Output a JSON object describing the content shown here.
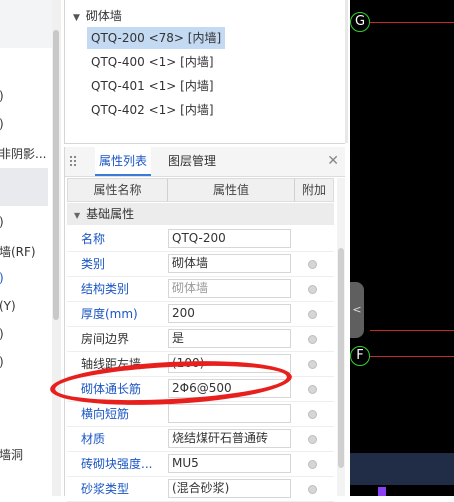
{
  "left_partial": {
    "items": [
      {
        "text": ")",
        "style": "normal"
      },
      {
        "text": ")",
        "style": "normal"
      },
      {
        "text": "非阴影...",
        "style": "normal"
      },
      {
        "text": ")",
        "style": "normal"
      },
      {
        "text": "墙(RF)",
        "style": "normal"
      },
      {
        "text": ")",
        "style": "blue"
      },
      {
        "text": "(Y)",
        "style": "normal"
      },
      {
        "text": ")",
        "style": "normal"
      },
      {
        "text": ")",
        "style": "normal"
      },
      {
        "text": "墙洞",
        "style": "normal"
      }
    ]
  },
  "tree": {
    "root_label": "砌体墙",
    "items": [
      {
        "label": "QTQ-200 <78> [内墙]",
        "selected": true
      },
      {
        "label": "QTQ-400 <1> [内墙]",
        "selected": false
      },
      {
        "label": "QTQ-401 <1> [内墙]",
        "selected": false
      },
      {
        "label": "QTQ-402 <1> [内墙]",
        "selected": false
      }
    ]
  },
  "properties": {
    "tabs": [
      {
        "label": "属性列表",
        "active": true
      },
      {
        "label": "图层管理",
        "active": false
      }
    ],
    "columns": {
      "name": "属性名称",
      "value": "属性值",
      "extra": "附加"
    },
    "group": "基础属性",
    "rows": [
      {
        "name": "名称",
        "value": "QTQ-200",
        "name_style": "blue",
        "value_style": "normal",
        "checkbox": false
      },
      {
        "name": "类别",
        "value": "砌体墙",
        "name_style": "blue",
        "value_style": "normal",
        "checkbox": true
      },
      {
        "name": "结构类别",
        "value": "砌体墙",
        "name_style": "blue",
        "value_style": "gray",
        "checkbox": true
      },
      {
        "name": "厚度(mm)",
        "value": "200",
        "name_style": "blue",
        "value_style": "normal",
        "checkbox": true
      },
      {
        "name": "房间边界",
        "value": "是",
        "name_style": "black",
        "value_style": "normal",
        "checkbox": true
      },
      {
        "name": "轴线距左墙...",
        "value": "(100)",
        "name_style": "black",
        "value_style": "normal",
        "checkbox": true
      },
      {
        "name": "砌体通长筋",
        "value": "2Φ6@500",
        "name_style": "blue",
        "value_style": "normal",
        "checkbox": true
      },
      {
        "name": "横向短筋",
        "value": "",
        "name_style": "blue",
        "value_style": "normal",
        "checkbox": true
      },
      {
        "name": "材质",
        "value": "烧结煤矸石普通砖",
        "name_style": "blue",
        "value_style": "normal",
        "checkbox": true
      },
      {
        "name": "砖砌块强度...",
        "value": "MU5",
        "name_style": "blue",
        "value_style": "normal",
        "checkbox": true
      },
      {
        "name": "砂浆类型",
        "value": "(混合砂浆)",
        "name_style": "blue",
        "value_style": "normal",
        "checkbox": true
      }
    ]
  },
  "canvas": {
    "axis_labels": [
      "G",
      "F"
    ],
    "collapse_icon": "chevron-left-icon",
    "colors": {
      "grid_line": "#c22b2b",
      "axis_bubble": "#2fd12f",
      "annotation": "#e8201d"
    }
  }
}
